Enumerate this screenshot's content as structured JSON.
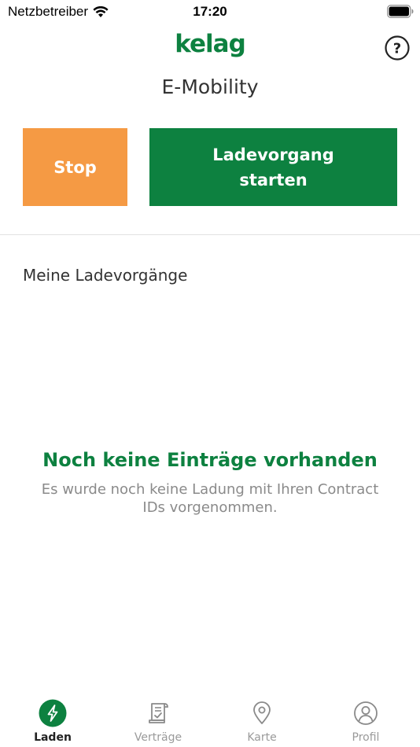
{
  "status_bar": {
    "carrier": "Netzbetreiber",
    "time": "17:20"
  },
  "header": {
    "logo": "kelag",
    "title": "E-Mobility",
    "help_icon": "question-circle-icon"
  },
  "actions": {
    "stop_label": "Stop",
    "start_label_line1": "Ladevorgang",
    "start_label_line2": "starten"
  },
  "section": {
    "title": "Meine Ladevorgänge"
  },
  "empty_state": {
    "title": "Noch keine Einträge vorhanden",
    "text": "Es wurde noch keine Ladung mit Ihren Contract IDs vorgenommen."
  },
  "tabs": [
    {
      "label": "Laden",
      "icon": "charge-bolt-icon",
      "active": true
    },
    {
      "label": "Verträge",
      "icon": "contract-document-icon",
      "active": false
    },
    {
      "label": "Karte",
      "icon": "map-pin-icon",
      "active": false
    },
    {
      "label": "Profil",
      "icon": "user-circle-icon",
      "active": false
    }
  ],
  "colors": {
    "brand_green": "#0d8140",
    "stop_orange": "#f59a44",
    "text_dark": "#333333",
    "text_muted": "#8a8a8a"
  }
}
